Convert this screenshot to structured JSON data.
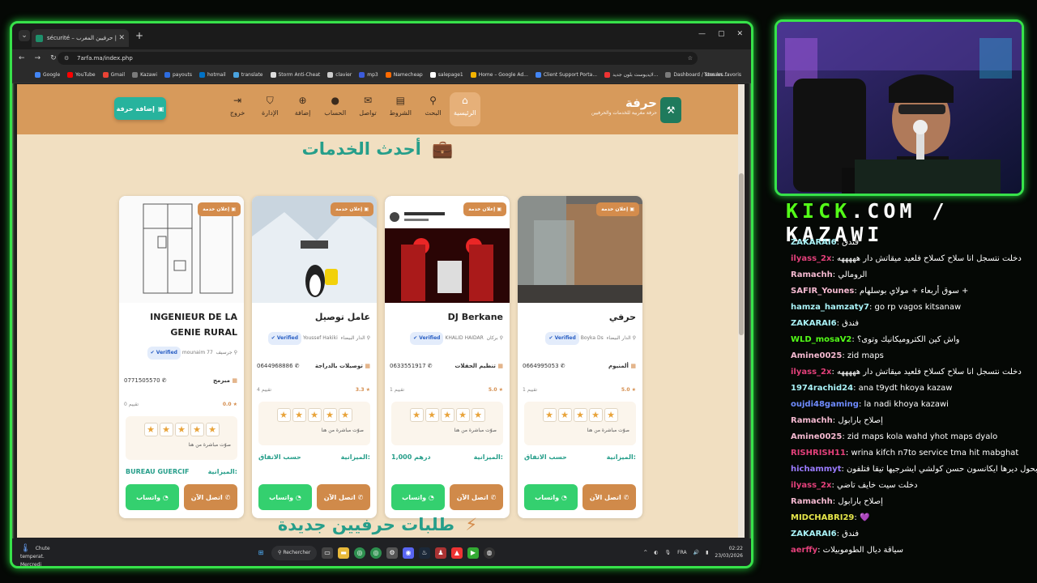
{
  "browser": {
    "tab_title": "sécurité – حرفة | حرفيين المغرب",
    "url": "7arfa.ma/index.php",
    "bookmarks": [
      "Google",
      "YouTube",
      "Gmail",
      "Kazawi",
      "payouts",
      "hotmail",
      "translate",
      "Storm Anti-Cheat",
      "clavier",
      "mp3",
      "Namecheap",
      "salepage1",
      "Home – Google Ad...",
      "Client Support Porta...",
      "لايديوست بلون جديد...",
      "Dashboard / Stream..."
    ],
    "bookmarks_all": "Tous les favoris"
  },
  "site": {
    "brand_name": "حرفة",
    "brand_tagline": "حرفة مغربية للخدمات والحرفيين",
    "nav": [
      {
        "label": "الرئيسية",
        "icon": "⌂"
      },
      {
        "label": "البحث",
        "icon": "⚲"
      },
      {
        "label": "الشروط",
        "icon": "▤"
      },
      {
        "label": "تواصل",
        "icon": "✉"
      },
      {
        "label": "الحساب",
        "icon": "●"
      },
      {
        "label": "إضافة",
        "icon": "⊕"
      },
      {
        "label": "الإدارة",
        "icon": "⛉"
      },
      {
        "label": "خروج",
        "icon": "⇥"
      }
    ],
    "add_button": "إضافة حرفة",
    "section_latest": "أحدث الخدمات",
    "section_requests": "طلبات حرفيين جديدة"
  },
  "cards": [
    {
      "badge": "إعلان خدمة",
      "title": "حرفي",
      "city": "الدار البيضاء",
      "user": "Boyka Ds",
      "verified": "Verified",
      "category": "ألمنيوم",
      "phone": "0664995053",
      "score": "5.0",
      "reviews": "1 تقييم",
      "vote_label": "صوّت مباشرة من هنا",
      "budget_label": "الميزانية:",
      "budget": "حسب الاتفاق",
      "whatsapp": "واتساب",
      "call": "اتصل الآن"
    },
    {
      "badge": "إعلان خدمة",
      "title": "DJ Berkane",
      "city": "بركان",
      "user": "KHALID HAIDAR",
      "verified": "Verified",
      "category": "تنظيم الحفلات",
      "phone": "0633551917",
      "score": "5.0",
      "reviews": "1 تقييم",
      "vote_label": "صوّت مباشرة من هنا",
      "budget_label": "الميزانية:",
      "budget": "1,000 درهم",
      "whatsapp": "واتساب",
      "call": "اتصل الآن"
    },
    {
      "badge": "إعلان خدمة",
      "title": "عامل توصيل",
      "city": "الدار البيضاء",
      "user": "Youssef Hakiki",
      "verified": "Verified",
      "category": "توصيلات بالدراجة",
      "phone": "0644968886",
      "score": "3.3",
      "reviews": "4 تقييم",
      "vote_label": "صوّت مباشرة من هنا",
      "budget_label": "الميزانية:",
      "budget": "حسب الاتفاق",
      "whatsapp": "واتساب",
      "call": "اتصل الآن"
    },
    {
      "badge": "إعلان خدمة",
      "title": "INGENIEUR DE LA GENIE RURAL",
      "city": "جرسيف",
      "user": "mounaim 77",
      "verified": "Verified",
      "category": "مبرمج",
      "phone": "0771505570",
      "score": "0.0",
      "reviews": "0 تقييم",
      "vote_label": "صوّت مباشرة من هنا",
      "budget_label": "الميزانية:",
      "budget": "BUREAU GUERCIF",
      "whatsapp": "واتساب",
      "call": "اتصل الآن"
    }
  ],
  "taskbar": {
    "weather": "Chute temperat.",
    "weather_sub": "Mercredi",
    "search": "Rechercher",
    "lang": "FRA",
    "time": "02:22",
    "date": "23/03/2026"
  },
  "stream": {
    "kick_prefix": "KICK",
    "kick_rest": ".COM / KAZAWI",
    "chat": [
      {
        "user": "ZAKARAI6",
        "color": "#a9f2f7",
        "msg": "فندق"
      },
      {
        "user": "ilyass_2x",
        "color": "#e3407a",
        "msg": "دخلت نتسجل انا سلاح كسلاح فلعيد ميقاتش دار هههههه"
      },
      {
        "user": "Ramachh",
        "color": "#f4b9d0",
        "msg": "الرومالي"
      },
      {
        "user": "SAFIR_Younes",
        "color": "#f4b9d0",
        "msg": "سوق أربعاء + مولاي بوسلهام +"
      },
      {
        "user": "hamza_hamzaty7",
        "color": "#a9f2f7",
        "msg": "go rp vagos kitsanaw"
      },
      {
        "user": "ZAKARAI6",
        "color": "#a9f2f7",
        "msg": "فندق"
      },
      {
        "user": "WLD_mosaV2",
        "color": "#53fc18",
        "msg": "واش كين الكتروميكانيك وتوى؟"
      },
      {
        "user": "Amine0025",
        "color": "#f4b9d0",
        "msg": "zid maps"
      },
      {
        "user": "ilyass_2x",
        "color": "#e3407a",
        "msg": "دخلت نتسجل انا سلاح كسلاح فلعيد ميقاتش دار هههههه"
      },
      {
        "user": "1974rachid24",
        "color": "#a9f2f7",
        "msg": "ana t9ydt hkoya kazaw"
      },
      {
        "user": "oujdi48gaming",
        "color": "#6f8bff",
        "msg": "la nadi khoya kazawi"
      },
      {
        "user": "Ramachh",
        "color": "#f4b9d0",
        "msg": "إصلاح بارابول"
      },
      {
        "user": "Amine0025",
        "color": "#f4b9d0",
        "msg": "zid maps kola wahd yhot maps dyalo"
      },
      {
        "user": "RISHRISH11",
        "color": "#e3407a",
        "msg": "wrina kifch n7to service tma hit mabghat"
      },
      {
        "user": "hichammyt",
        "color": "#9a7bff",
        "msg": "بحول ديرها ايكانسون حسن كولشي ايشرجيها تيقا فتلفون"
      },
      {
        "user": "ilyass_2x",
        "color": "#e3407a",
        "msg": "دخلت سيت خايف تاضي"
      },
      {
        "user": "Ramachh",
        "color": "#f4b9d0",
        "msg": "إصلاح بارابول"
      },
      {
        "user": "MIDCHABRI29",
        "color": "#e6e64a",
        "msg": "💜"
      },
      {
        "user": "ZAKARAI6",
        "color": "#a9f2f7",
        "msg": "فندق"
      },
      {
        "user": "aerffy",
        "color": "#e3407a",
        "msg": "سياقة ديال الطوموبيلات"
      }
    ]
  }
}
